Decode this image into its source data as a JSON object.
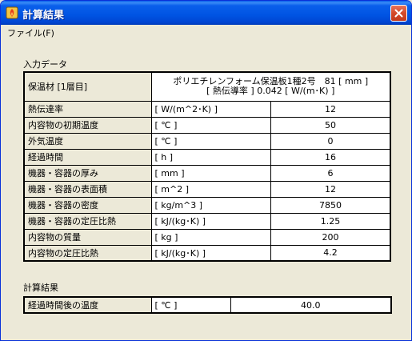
{
  "window": {
    "title": "計算結果"
  },
  "menu": {
    "file_label": "ファイル(F)"
  },
  "input": {
    "section_label": "入力データ",
    "material": {
      "name": "保温材 [1層目]",
      "value_line1": "ポリエチレンフォーム保温板1種2号　81 [ mm ]",
      "value_line2": "[ 熱伝導率 ] 0.042 [ W/(m･K) ]"
    },
    "rows": [
      {
        "name": "熱伝達率",
        "unit": "[ W/(m^2･K) ]",
        "value": "12"
      },
      {
        "name": "内容物の初期温度",
        "unit": "[ ℃ ]",
        "value": "50"
      },
      {
        "name": "外気温度",
        "unit": "[ ℃ ]",
        "value": "0"
      },
      {
        "name": "経過時間",
        "unit": "[ h ]",
        "value": "16"
      },
      {
        "name": "機器・容器の厚み",
        "unit": "[ mm ]",
        "value": "6"
      },
      {
        "name": "機器・容器の表面積",
        "unit": "[ m^2 ]",
        "value": "12"
      },
      {
        "name": "機器・容器の密度",
        "unit": "[ kg/m^3 ]",
        "value": "7850"
      },
      {
        "name": "機器・容器の定圧比熱",
        "unit": "[ kJ/(kg･K) ]",
        "value": "1.25"
      },
      {
        "name": "内容物の質量",
        "unit": "[ kg ]",
        "value": "200"
      },
      {
        "name": "内容物の定圧比熱",
        "unit": "[ kJ/(kg･K) ]",
        "value": "4.2"
      }
    ]
  },
  "result": {
    "section_label": "計算結果",
    "rows": [
      {
        "name": "経過時間後の温度",
        "unit": "[ ℃ ]",
        "value": "40.0"
      }
    ]
  }
}
